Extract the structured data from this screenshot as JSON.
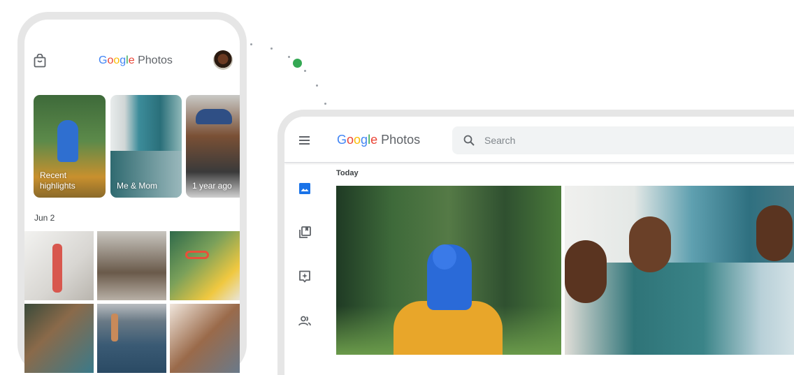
{
  "phone": {
    "logo": {
      "google": [
        "G",
        "o",
        "o",
        "g",
        "l",
        "e"
      ],
      "product": "Photos"
    },
    "shop_icon": "shopping-bag-icon",
    "avatar_alt": "profile-avatar",
    "memories": [
      {
        "label": "Recent highlights"
      },
      {
        "label": "Me & Mom"
      },
      {
        "label": "1 year ago"
      }
    ],
    "date_heading": "Jun 2",
    "photos": [
      "woman-stretching-with-child",
      "kids-playing-on-floor",
      "child-with-red-sunglasses",
      "friends-smiling",
      "person-jumping-into-lake",
      "man-laughing"
    ]
  },
  "laptop": {
    "logo": {
      "google": [
        "G",
        "o",
        "o",
        "g",
        "l",
        "e"
      ],
      "product": "Photos"
    },
    "search": {
      "placeholder": "Search",
      "value": ""
    },
    "sidebar": [
      {
        "name": "photos",
        "icon": "photo-icon",
        "active": true
      },
      {
        "name": "albums",
        "icon": "album-icon",
        "active": false
      },
      {
        "name": "for-you",
        "icon": "assistant-icon",
        "active": false
      },
      {
        "name": "sharing",
        "icon": "people-icon",
        "active": false
      }
    ],
    "date_heading": "Today",
    "photos": [
      "child-on-shoulders-in-forest",
      "family-laughing-on-couch"
    ]
  },
  "colors": {
    "accent": "#1a73e8",
    "green_dot": "#34A853"
  }
}
